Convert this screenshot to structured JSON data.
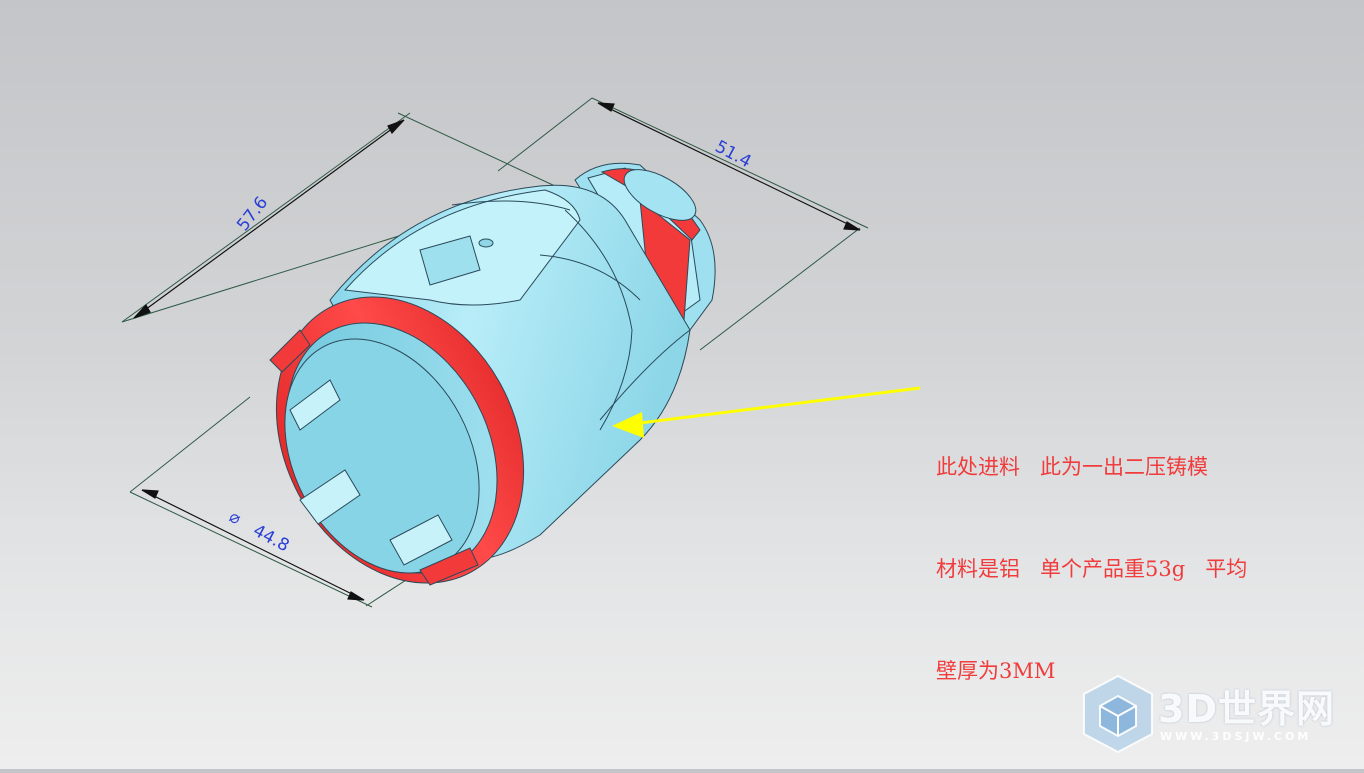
{
  "dimensions": {
    "length_overall": "57.6",
    "length_rear": "51.4",
    "diameter_value": "44.8",
    "diameter_symbol": "⌀"
  },
  "annotation": {
    "line1": "此处进料   此为一出二压铸模",
    "line2": "材料是铝   单个产品重53g   平均",
    "line3": "壁厚为3MM"
  },
  "watermark": {
    "title": "3D世界网",
    "url": "WWW.3DSJW.COM"
  },
  "colors": {
    "part_body": "#a8e4f0",
    "part_edge": "#2a4a5a",
    "gate_face": "#f23a3a",
    "dimension_text": "#2a3fd6",
    "arrow": "#ffff00",
    "note_text": "#f03c3c"
  }
}
